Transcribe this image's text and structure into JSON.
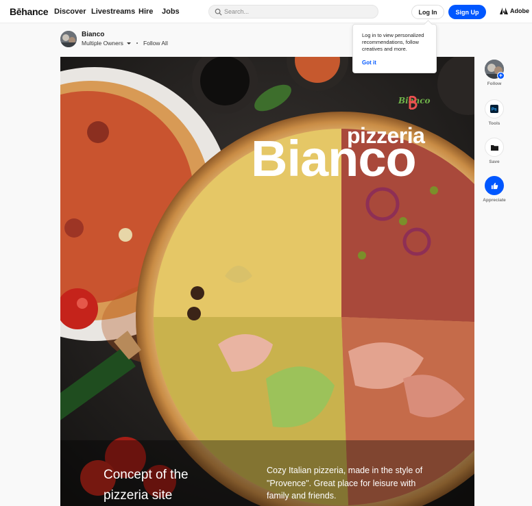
{
  "header": {
    "logo": "Bēhance",
    "nav": [
      "Discover",
      "Livestreams",
      "Hire",
      "Jobs"
    ],
    "search_placeholder": "Search...",
    "login_label": "Log In",
    "signup_label": "Sign Up",
    "adobe_label": "Adobe",
    "accent_color": "#0057ff"
  },
  "owner": {
    "name": "Bianco",
    "owners_label": "Multiple Owners",
    "follow_all_label": "Follow All"
  },
  "tooltip": {
    "text": "Log in to view personalized recommendations, follow creatives and more.",
    "button_label": "Got it"
  },
  "project": {
    "brand_small": "Bianco",
    "headline_small": "pizzeria",
    "headline_large": "Bianco",
    "concept": "Concept of the pizzeria site",
    "description": "Cozy Italian pizzeria, made in the style of \"Provence\". Great place for leisure with family and friends."
  },
  "side_actions": [
    {
      "label": "Follow",
      "icon": "avatar-plus-icon"
    },
    {
      "label": "Tools",
      "icon": "photoshop-icon"
    },
    {
      "label": "Save",
      "icon": "folder-icon"
    },
    {
      "label": "Appreciate",
      "icon": "thumbs-up-icon"
    }
  ]
}
